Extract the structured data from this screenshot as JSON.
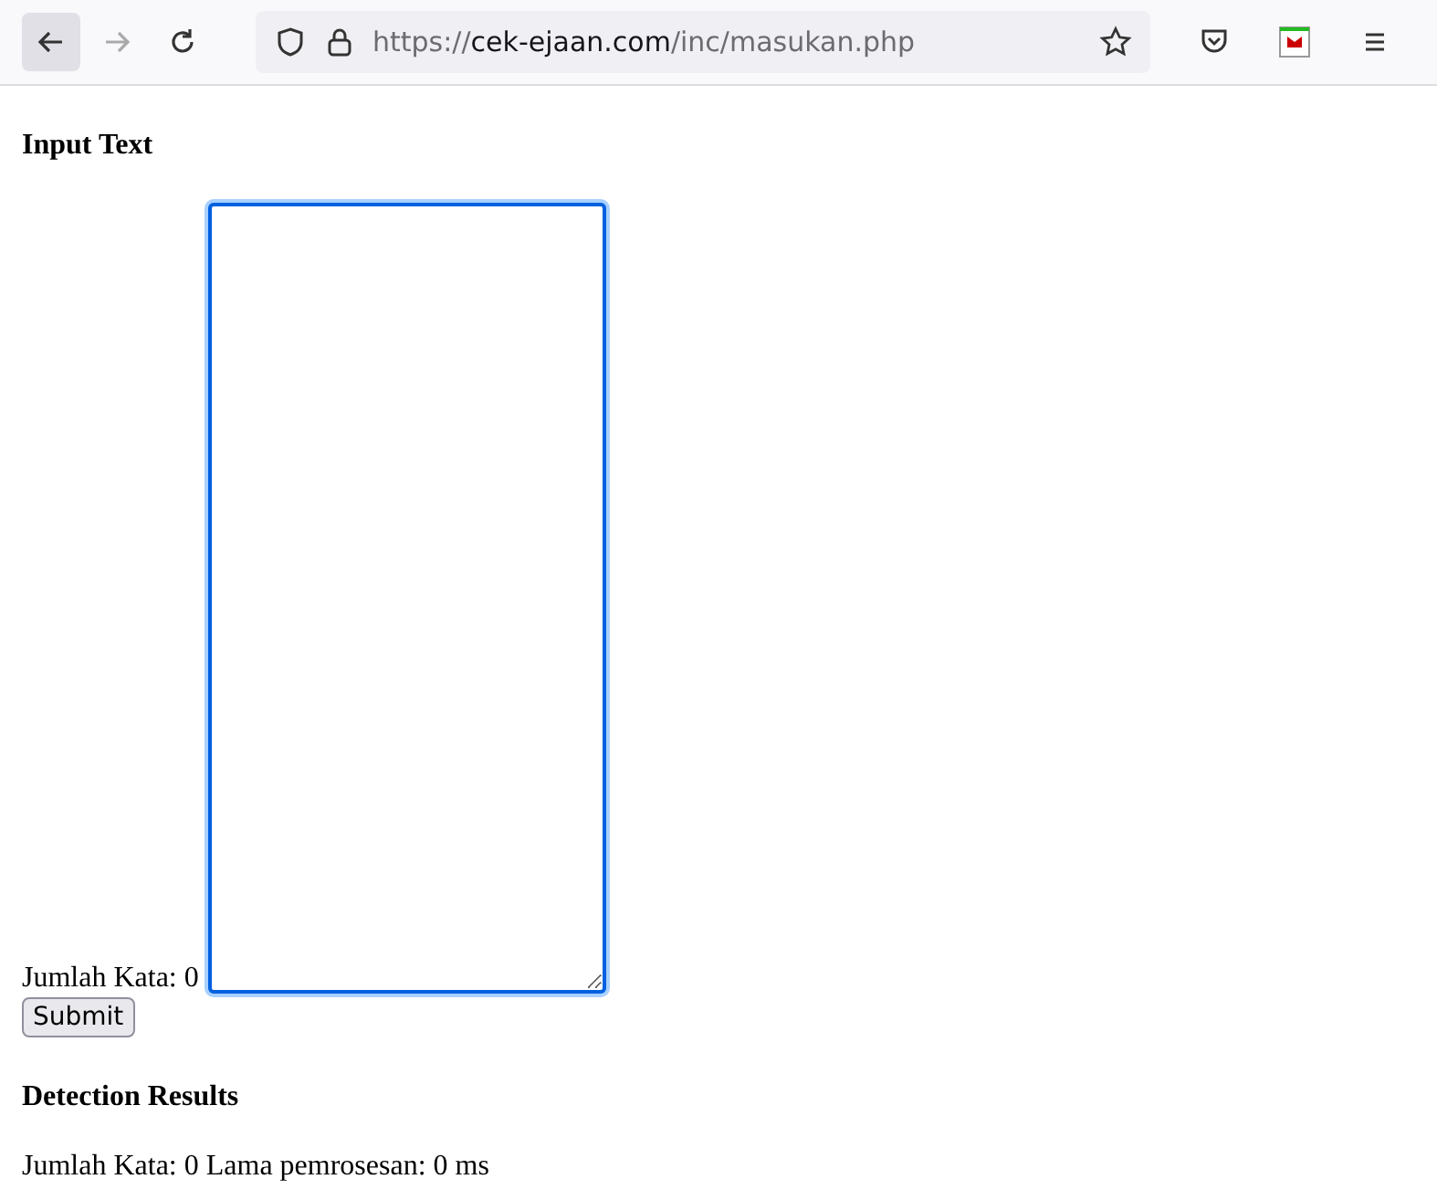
{
  "browser": {
    "url_scheme": "https://",
    "url_host": "cek-ejaan.com",
    "url_path": "/inc/masukan.php"
  },
  "input_section": {
    "heading": "Input Text",
    "word_count": "Jumlah Kata: 0",
    "focused": true,
    "submit": "Submit"
  },
  "results": {
    "heading": "Detection Results",
    "summary": "Jumlah Kata: 0 Lama pemrosesan: 0 ms"
  }
}
